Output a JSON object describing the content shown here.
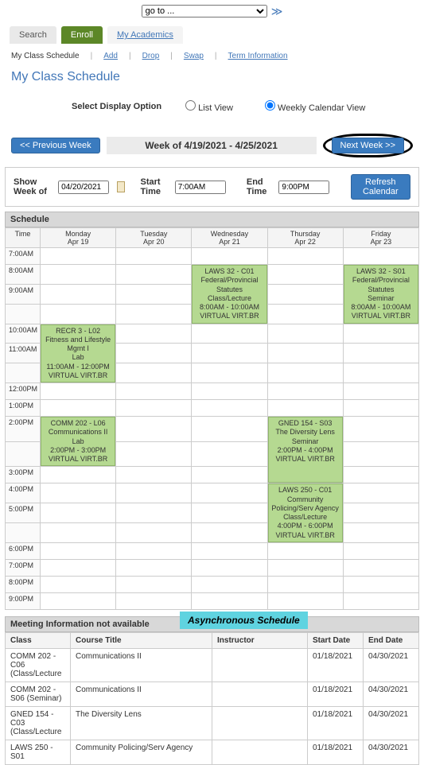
{
  "top_nav": {
    "select_value": "go to ..."
  },
  "tabs": {
    "search": "Search",
    "enroll": "Enroll",
    "academics": "My Academics"
  },
  "subnav": {
    "current": "My Class Schedule",
    "add": "Add",
    "drop": "Drop",
    "swap": "Swap",
    "term": "Term Information"
  },
  "page_title": "My Class Schedule",
  "display": {
    "label": "Select Display Option",
    "list": "List View",
    "weekly": "Weekly Calendar View"
  },
  "weeknav": {
    "prev": "<< Previous Week",
    "range": "Week of 4/19/2021 - 4/25/2021",
    "next": "Next Week >>"
  },
  "filter": {
    "show_label": "Show Week of",
    "show_value": "04/20/2021",
    "start_label": "Start Time",
    "start_value": "7:00AM",
    "end_label": "End Time",
    "end_value": "9:00PM",
    "refresh": "Refresh Calendar"
  },
  "schedule": {
    "title": "Schedule",
    "time_header": "Time",
    "days": [
      {
        "name": "Monday",
        "date": "Apr 19"
      },
      {
        "name": "Tuesday",
        "date": "Apr 20"
      },
      {
        "name": "Wednesday",
        "date": "Apr 21"
      },
      {
        "name": "Thursday",
        "date": "Apr 22"
      },
      {
        "name": "Friday",
        "date": "Apr 23"
      }
    ],
    "times": [
      "7:00AM",
      "8:00AM",
      "9:00AM",
      "10:00AM",
      "11:00AM",
      "12:00PM",
      "1:00PM",
      "2:00PM",
      "3:00PM",
      "4:00PM",
      "5:00PM",
      "6:00PM",
      "7:00PM",
      "8:00PM",
      "9:00PM"
    ],
    "events": {
      "wed_8": {
        "l1": "LAWS 32 - C01",
        "l2": "Federal/Provincial",
        "l3": "Statutes",
        "l4": "Class/Lecture",
        "l5": "8:00AM - 10:00AM",
        "l6": "VIRTUAL VIRT.BR"
      },
      "fri_8": {
        "l1": "LAWS 32 - S01",
        "l2": "Federal/Provincial",
        "l3": "Statutes",
        "l4": "Seminar",
        "l5": "8:00AM - 10:00AM",
        "l6": "VIRTUAL VIRT.BR"
      },
      "mon_11": {
        "l1": "RECR 3 - L02",
        "l2": "Fitness and Lifestyle",
        "l3": "Mgmt I",
        "l4": "Lab",
        "l5": "11:00AM - 12:00PM",
        "l6": "VIRTUAL VIRT.BR"
      },
      "mon_2": {
        "l1": "COMM 202 - L06",
        "l2": "Communications II",
        "l3": "Lab",
        "l4": "2:00PM - 3:00PM",
        "l5": "VIRTUAL VIRT.BR"
      },
      "thu_2": {
        "l1": "GNED 154 - S03",
        "l2": "The Diversity Lens",
        "l3": "Seminar",
        "l4": "2:00PM - 4:00PM",
        "l5": "VIRTUAL VIRT.BR"
      },
      "thu_4": {
        "l1": "LAWS 250 - C01",
        "l2": "Community",
        "l3": "Policing/Serv Agency",
        "l4": "Class/Lecture",
        "l5": "4:00PM - 6:00PM",
        "l6": "VIRTUAL VIRT.BR"
      }
    }
  },
  "meeting": {
    "title": "Meeting Information not available",
    "badge": "Asynchronous Schedule",
    "headers": {
      "class": "Class",
      "course": "Course Title",
      "instructor": "Instructor",
      "start": "Start Date",
      "end": "End Date"
    },
    "rows": [
      {
        "class": "COMM  202 - C06 (Class/Lecture",
        "course": "Communications II",
        "instructor": "",
        "start": "01/18/2021",
        "end": "04/30/2021"
      },
      {
        "class": "COMM  202 - S06 (Seminar)",
        "course": "Communications II",
        "instructor": "",
        "start": "01/18/2021",
        "end": "04/30/2021"
      },
      {
        "class": "GNED  154 - C03 (Class/Lecture",
        "course": "The Diversity Lens",
        "instructor": "",
        "start": "01/18/2021",
        "end": "04/30/2021"
      },
      {
        "class": "LAWS  250 - S01",
        "course": "Community Policing/Serv Agency",
        "instructor": "",
        "start": "01/18/2021",
        "end": "04/30/2021"
      }
    ]
  }
}
